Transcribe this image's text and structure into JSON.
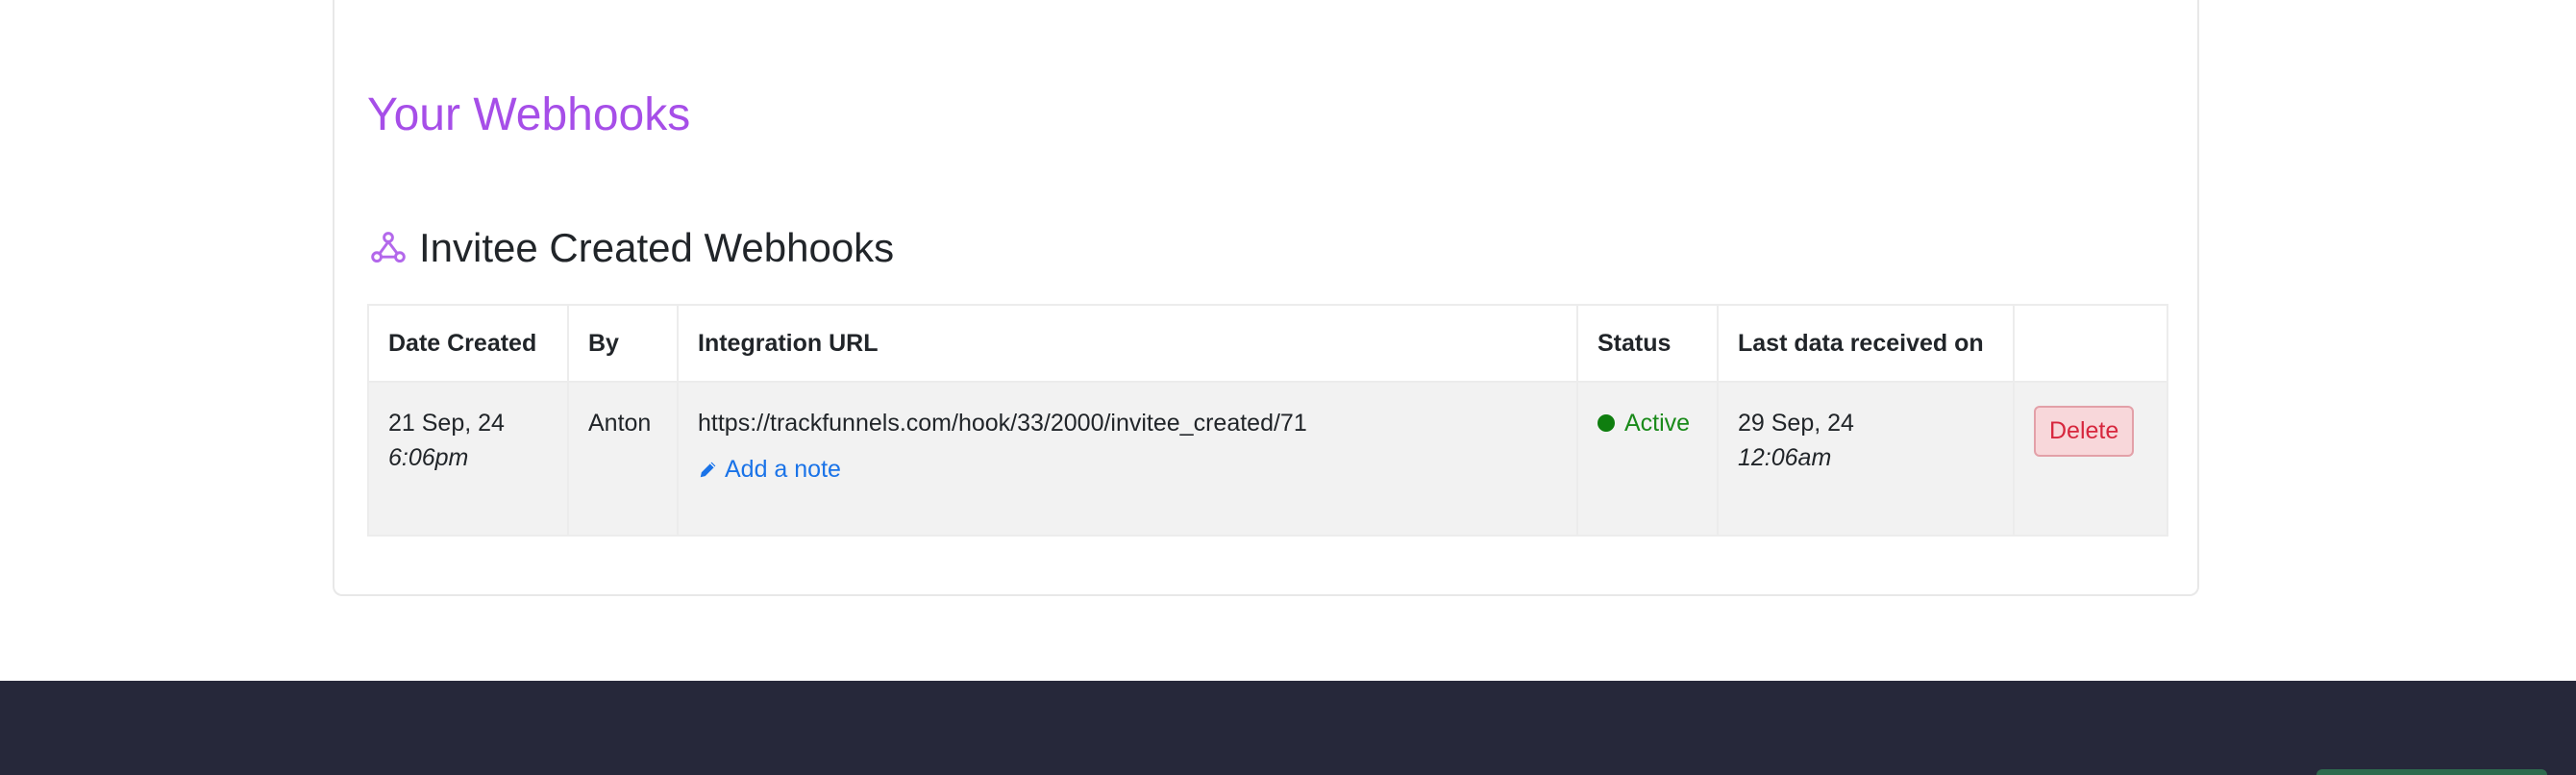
{
  "page": {
    "title": "Your Webhooks"
  },
  "section": {
    "icon": "webhook-icon",
    "heading": "Invitee Created Webhooks"
  },
  "table": {
    "columns": [
      "Date Created",
      "By",
      "Integration URL",
      "Status",
      "Last data received on",
      ""
    ],
    "rows": [
      {
        "date": "21 Sep, 24",
        "time": "6:06pm",
        "by": "Anton",
        "url": "https://trackfunnels.com/hook/33/2000/invitee_created/71",
        "note_label": "Add a note",
        "status": "Active",
        "last_date": "29 Sep, 24",
        "last_time": "12:06am",
        "delete_label": "Delete"
      }
    ]
  },
  "colors": {
    "title": "#a64ee8",
    "link": "#1a73e8",
    "status_active": "#1a8a1a",
    "delete_text": "#d7263d",
    "delete_bg": "#f8d7da",
    "footer_bg": "#26283a"
  }
}
